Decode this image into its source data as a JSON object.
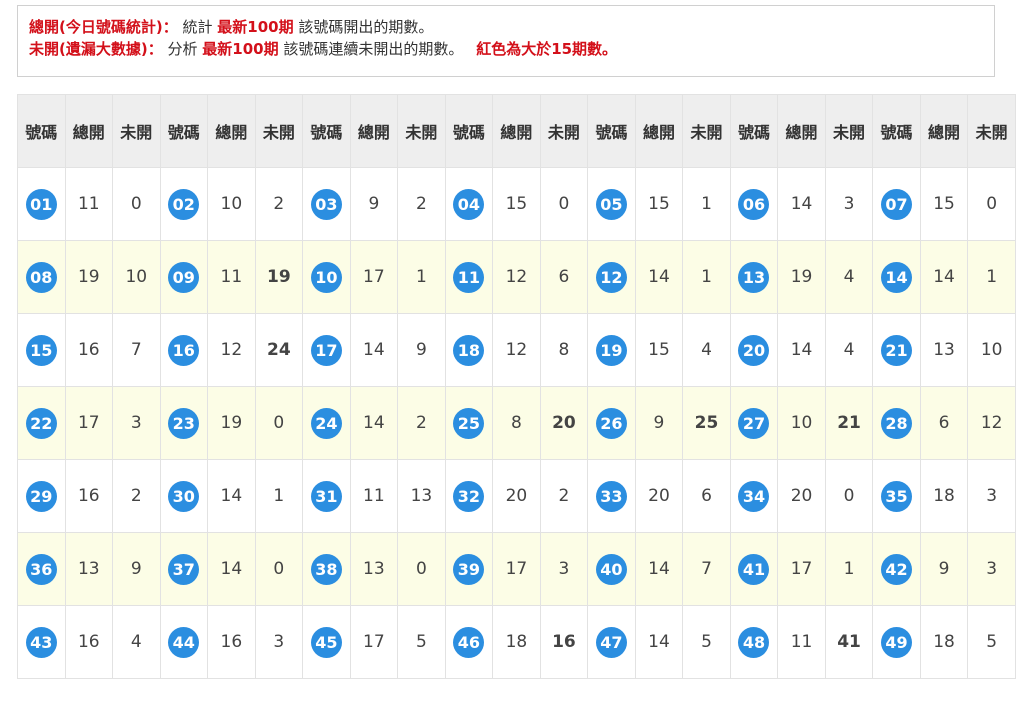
{
  "notice": {
    "line1": {
      "label": "總開(今日號碼統計)：",
      "text_a": "統計",
      "highlight": "最新100期",
      "text_b": "該號碼開出的期數。"
    },
    "line2": {
      "label": "未開(遺漏大數據)：",
      "text_a": "分析",
      "highlight": "最新100期",
      "text_b": "該號碼連續未開出的期數。",
      "note": "紅色為大於15期數。"
    }
  },
  "headers": [
    "號碼",
    "總開",
    "未開",
    "號碼",
    "總開",
    "未開",
    "號碼",
    "總開",
    "未開",
    "號碼",
    "總開",
    "未開",
    "號碼",
    "總開",
    "未開",
    "號碼",
    "總開",
    "未開",
    "號碼",
    "總開",
    "未開"
  ],
  "rows": [
    [
      [
        "01",
        "11",
        "0"
      ],
      [
        "02",
        "10",
        "2"
      ],
      [
        "03",
        "9",
        "2"
      ],
      [
        "04",
        "15",
        "0"
      ],
      [
        "05",
        "15",
        "1"
      ],
      [
        "06",
        "14",
        "3"
      ],
      [
        "07",
        "15",
        "0"
      ]
    ],
    [
      [
        "08",
        "19",
        "10"
      ],
      [
        "09",
        "11",
        "19"
      ],
      [
        "10",
        "17",
        "1"
      ],
      [
        "11",
        "12",
        "6"
      ],
      [
        "12",
        "14",
        "1"
      ],
      [
        "13",
        "19",
        "4"
      ],
      [
        "14",
        "14",
        "1"
      ]
    ],
    [
      [
        "15",
        "16",
        "7"
      ],
      [
        "16",
        "12",
        "24"
      ],
      [
        "17",
        "14",
        "9"
      ],
      [
        "18",
        "12",
        "8"
      ],
      [
        "19",
        "15",
        "4"
      ],
      [
        "20",
        "14",
        "4"
      ],
      [
        "21",
        "13",
        "10"
      ]
    ],
    [
      [
        "22",
        "17",
        "3"
      ],
      [
        "23",
        "19",
        "0"
      ],
      [
        "24",
        "14",
        "2"
      ],
      [
        "25",
        "8",
        "20"
      ],
      [
        "26",
        "9",
        "25"
      ],
      [
        "27",
        "10",
        "21"
      ],
      [
        "28",
        "6",
        "12"
      ]
    ],
    [
      [
        "29",
        "16",
        "2"
      ],
      [
        "30",
        "14",
        "1"
      ],
      [
        "31",
        "11",
        "13"
      ],
      [
        "32",
        "20",
        "2"
      ],
      [
        "33",
        "20",
        "6"
      ],
      [
        "34",
        "20",
        "0"
      ],
      [
        "35",
        "18",
        "3"
      ]
    ],
    [
      [
        "36",
        "13",
        "9"
      ],
      [
        "37",
        "14",
        "0"
      ],
      [
        "38",
        "13",
        "0"
      ],
      [
        "39",
        "17",
        "3"
      ],
      [
        "40",
        "14",
        "7"
      ],
      [
        "41",
        "17",
        "1"
      ],
      [
        "42",
        "9",
        "3"
      ]
    ],
    [
      [
        "43",
        "16",
        "4"
      ],
      [
        "44",
        "16",
        "3"
      ],
      [
        "45",
        "17",
        "5"
      ],
      [
        "46",
        "18",
        "16"
      ],
      [
        "47",
        "14",
        "5"
      ],
      [
        "48",
        "11",
        "41"
      ],
      [
        "49",
        "18",
        "5"
      ]
    ]
  ],
  "hot_threshold": 15,
  "colors": {
    "ball": "#2b8ee0",
    "hot": "#d3101a",
    "header_bg": "#eeeeee",
    "alt_row_bg": "#fcfde6"
  }
}
